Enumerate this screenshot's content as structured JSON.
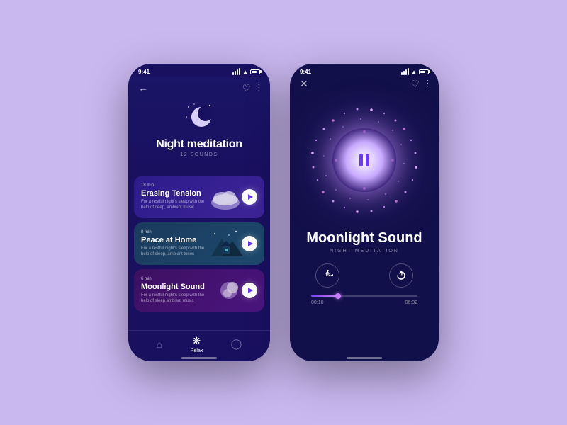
{
  "background": "#c9b8f0",
  "phone1": {
    "status_time": "9:41",
    "header_title": "Night meditation",
    "header_subtitle": "12 SOUNDS",
    "back_icon": "←",
    "heart_icon": "♡",
    "filter_icon": "⫶",
    "sounds": [
      {
        "id": 1,
        "duration": "18 min",
        "name": "Erasing Tension",
        "description": "For a restful night's sleep with the help of deep, ambient music",
        "color_class": "sound-card-1"
      },
      {
        "id": 2,
        "duration": "8 min",
        "name": "Peace at Home",
        "description": "For a restful night's sleep with the help of sleep, ambient tones",
        "color_class": "sound-card-2"
      },
      {
        "id": 3,
        "duration": "6 min",
        "name": "Moonlight Sound",
        "description": "For a restful night's sleep with the help of sleep ambient music",
        "color_class": "sound-card-3"
      }
    ],
    "nav": [
      {
        "icon": "⌂",
        "label": "",
        "active": false
      },
      {
        "icon": "✿",
        "label": "Relax",
        "active": true
      },
      {
        "icon": "◯",
        "label": "",
        "active": false
      }
    ]
  },
  "phone2": {
    "status_time": "9:41",
    "close_icon": "✕",
    "heart_icon": "♡",
    "filter_icon": "⫶",
    "track_name": "Moonlight Sound",
    "track_category": "NIGHT MEDITATION",
    "rewind_label": "15",
    "forward_label": "15",
    "time_current": "00:10",
    "time_total": "06:32",
    "progress_percent": 25
  }
}
